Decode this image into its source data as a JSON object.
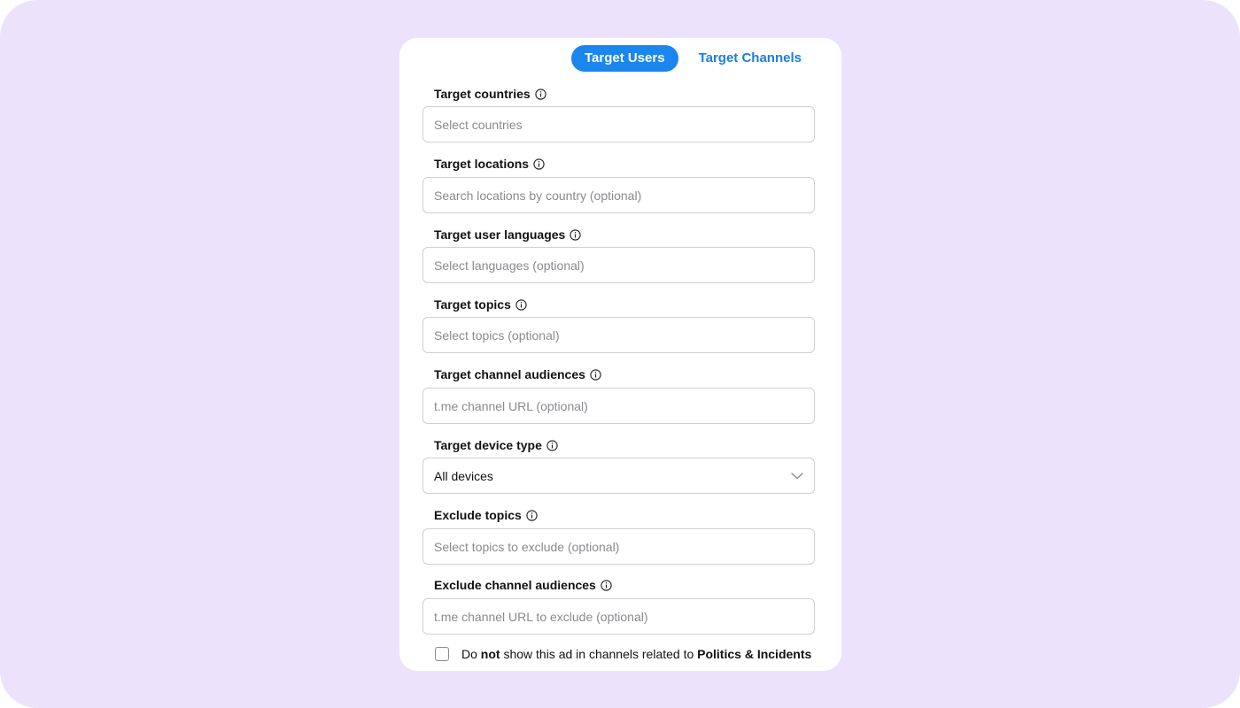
{
  "tabs": [
    {
      "label": "Target Users",
      "active": true
    },
    {
      "label": "Target Channels",
      "active": false
    }
  ],
  "fields": {
    "countries": {
      "label": "Target countries",
      "placeholder": "Select countries"
    },
    "locations": {
      "label": "Target locations",
      "placeholder": "Search locations by country (optional)"
    },
    "languages": {
      "label": "Target user languages",
      "placeholder": "Select languages (optional)"
    },
    "topics": {
      "label": "Target topics",
      "placeholder": "Select topics (optional)"
    },
    "channel_audiences": {
      "label": "Target channel audiences",
      "placeholder": "t.me channel URL (optional)"
    },
    "device_type": {
      "label": "Target device type",
      "value": "All devices"
    },
    "exclude_topics": {
      "label": "Exclude topics",
      "placeholder": "Select topics to exclude (optional)"
    },
    "exclude_channel_audiences": {
      "label": "Exclude channel audiences",
      "placeholder": "t.me channel URL to exclude (optional)"
    }
  },
  "politics_checkbox": {
    "text_1": "Do ",
    "text_bold_1": "not",
    "text_2": " show this ad in channels related to ",
    "text_bold_2": "Politics & Incidents",
    "checked": false
  },
  "icons": {
    "info": "info-icon",
    "chevron": "chevron-down-icon"
  },
  "colors": {
    "background": "#ece2fb",
    "accent": "#1a86ee",
    "accent_text": "#1a7fe0",
    "border": "#cfcfd4",
    "placeholder": "#8a8a8f"
  }
}
